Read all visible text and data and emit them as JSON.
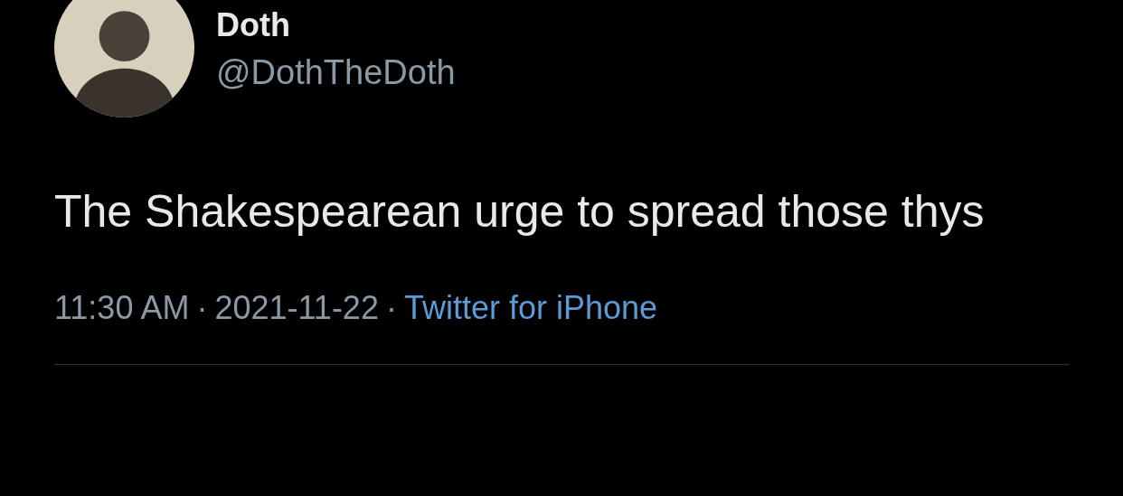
{
  "author": {
    "name": "Doth",
    "handle": "@DothTheDoth"
  },
  "tweet": {
    "text": "The Shakespearean urge to spread those thys"
  },
  "meta": [
    {
      "kind": "text",
      "text": "11:30 AM"
    },
    {
      "kind": "separator",
      "text": "·"
    },
    {
      "kind": "text",
      "text": "2021-11-22"
    },
    {
      "kind": "separator",
      "text": "·"
    },
    {
      "kind": "link",
      "text": "Twitter for iPhone"
    }
  ]
}
